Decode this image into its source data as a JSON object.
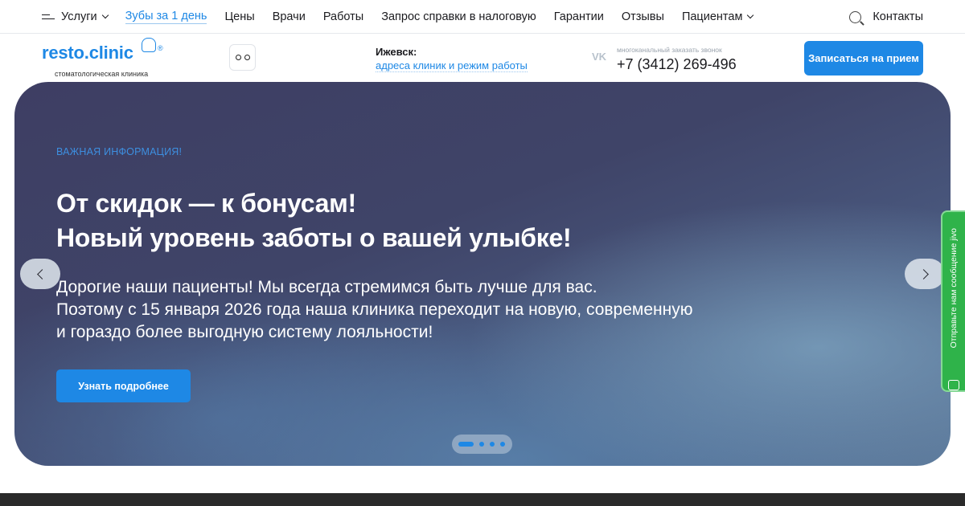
{
  "topnav": {
    "items": [
      {
        "label": "Услуги",
        "caret": true
      },
      {
        "label": "Зубы за 1 день",
        "accent": true
      },
      {
        "label": "Цены"
      },
      {
        "label": "Врачи"
      },
      {
        "label": "Работы"
      },
      {
        "label": "Запрос справки в налоговую"
      },
      {
        "label": "Гарантии"
      },
      {
        "label": "Отзывы"
      },
      {
        "label": "Пациентам",
        "caret": true
      }
    ],
    "contacts_label": "Контакты"
  },
  "header": {
    "logo_name": "resto.clinic",
    "logo_reg": "®",
    "logo_sub": "стоматологическая клиника",
    "city_label": "Ижевск:",
    "city_link": "адреса клиник и режим работы",
    "vk_label": "VK",
    "phone_hint": "многоканальный заказать звонок",
    "phone": "+7 (3412) 269-496",
    "cta_label": "Записаться на прием"
  },
  "hero": {
    "eyebrow": "ВАЖНАЯ ИНФОРМАЦИЯ!",
    "title_line1": "От скидок — к бонусам!",
    "title_line2": "Новый уровень заботы о вашей улыбке!",
    "body_line1": "Дорогие наши пациенты! Мы всегда стремимся быть лучше для вас.",
    "body_line2": "Поэтому с 15 января 2026 года наша клиника переходит на новую, современную",
    "body_line3": "и гораздо более выгодную систему лояльности!",
    "more_label": "Узнать подробнее",
    "slides_count": 4,
    "active_slide": 1
  },
  "jivo": {
    "text": "Отправьте нам сообщение jivo"
  },
  "colors": {
    "accent": "#1e88e5",
    "jivo_green": "#2fb34a"
  }
}
